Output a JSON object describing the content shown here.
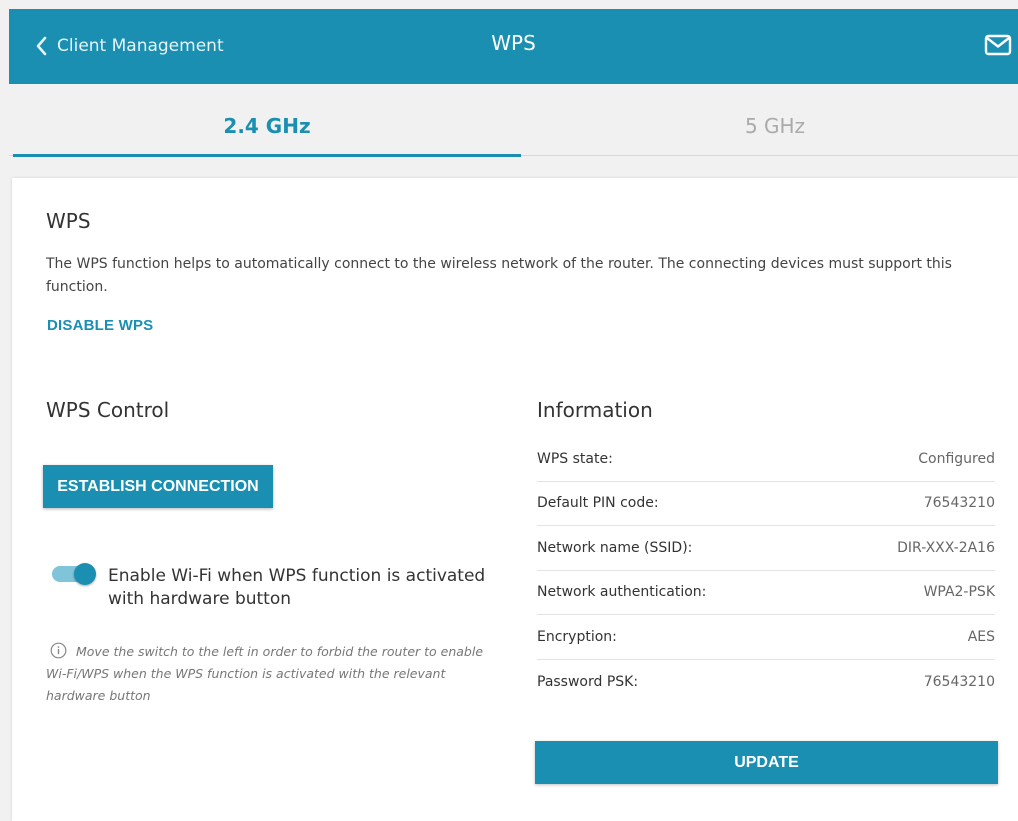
{
  "header": {
    "back_label": "Client Management",
    "title": "WPS",
    "back_icon": "chevron-left-icon",
    "mail_icon": "mail-icon"
  },
  "tabs": [
    {
      "label": "2.4 GHz",
      "active": true
    },
    {
      "label": "5 GHz",
      "active": false
    }
  ],
  "wps": {
    "heading": "WPS",
    "description": "The WPS function helps to automatically connect to the wireless network of the router. The connecting devices must support this function.",
    "disable_label": "DISABLE WPS"
  },
  "control": {
    "heading": "WPS Control",
    "establish_label": "ESTABLISH CONNECTION",
    "toggle_on": true,
    "toggle_label": "Enable Wi-Fi when WPS function is activated with hardware button",
    "hint": "Move the switch to the left in order to forbid the router to enable Wi-Fi/WPS when the WPS function is activated with the relevant hardware button",
    "hint_icon": "info-icon"
  },
  "information": {
    "heading": "Information",
    "rows": [
      {
        "key": "WPS state:",
        "value": "Configured"
      },
      {
        "key": "Default PIN code:",
        "value": "76543210"
      },
      {
        "key": "Network name (SSID):",
        "value": "DIR-XXX-2A16"
      },
      {
        "key": "Network authentication:",
        "value": "WPA2-PSK"
      },
      {
        "key": "Encryption:",
        "value": "AES"
      },
      {
        "key": "Password PSK:",
        "value": "76543210"
      }
    ],
    "update_label": "UPDATE"
  },
  "colors": {
    "accent": "#1a8fb1",
    "toggle_track": "#7fc4d8"
  }
}
